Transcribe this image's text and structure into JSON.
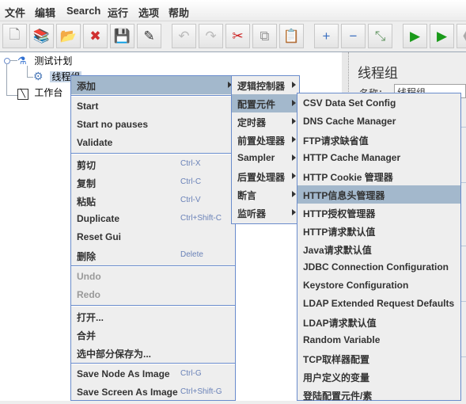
{
  "menubar": [
    "文件",
    "编辑",
    "Search",
    "运行",
    "选项",
    "帮助"
  ],
  "toolbar": [
    {
      "icon": "new-icon",
      "glyph": "🗋"
    },
    {
      "icon": "templates-icon",
      "glyph": "📚"
    },
    {
      "icon": "open-icon",
      "glyph": "📂"
    },
    {
      "icon": "close-icon",
      "glyph": "✖"
    },
    {
      "icon": "save-icon",
      "glyph": "💾"
    },
    {
      "icon": "save-as-icon",
      "glyph": "✎"
    },
    {
      "icon": "undo-icon",
      "glyph": "↶"
    },
    {
      "icon": "redo-icon",
      "glyph": "↷"
    },
    {
      "icon": "cut-icon",
      "glyph": "✂"
    },
    {
      "icon": "copy-icon",
      "glyph": "⧉"
    },
    {
      "icon": "paste-icon",
      "glyph": "📋"
    },
    {
      "icon": "expand-icon",
      "glyph": "+"
    },
    {
      "icon": "collapse-icon",
      "glyph": "−"
    },
    {
      "icon": "toggle-icon",
      "glyph": "⤡"
    },
    {
      "icon": "start-icon",
      "glyph": "▶"
    },
    {
      "icon": "start-no-pauses-icon",
      "glyph": "▶"
    },
    {
      "icon": "stop-icon",
      "glyph": "⬣"
    }
  ],
  "tree": {
    "test_plan": "测试计划",
    "thread_group": "线程组",
    "workbench": "工作台"
  },
  "right_panel": {
    "title": "线程组",
    "name_label": "名称：",
    "name_value": "线程组"
  },
  "context_menu": {
    "items": [
      {
        "label": "添加",
        "submenu": true,
        "selected": true
      },
      {
        "sep": true
      },
      {
        "label": "Start"
      },
      {
        "label": "Start no pauses"
      },
      {
        "label": "Validate"
      },
      {
        "sep": true
      },
      {
        "label": "剪切",
        "accel": "Ctrl-X"
      },
      {
        "label": "复制",
        "accel": "Ctrl-C"
      },
      {
        "label": "粘贴",
        "accel": "Ctrl-V"
      },
      {
        "label": "Duplicate",
        "accel": "Ctrl+Shift-C"
      },
      {
        "label": "Reset Gui"
      },
      {
        "label": "删除",
        "accel": "Delete"
      },
      {
        "sep": true
      },
      {
        "label": "Undo",
        "disabled": true
      },
      {
        "label": "Redo",
        "disabled": true
      },
      {
        "sep": true
      },
      {
        "label": "打开..."
      },
      {
        "label": "合并"
      },
      {
        "label": "选中部分保存为..."
      },
      {
        "sep": true
      },
      {
        "label": "Save Node As Image",
        "accel": "Ctrl-G"
      },
      {
        "label": "Save Screen As Image",
        "accel": "Ctrl+Shift-G"
      }
    ]
  },
  "add_submenu": {
    "items": [
      {
        "label": "逻辑控制器",
        "submenu": true
      },
      {
        "label": "配置元件",
        "submenu": true,
        "selected": true
      },
      {
        "label": "定时器",
        "submenu": true
      },
      {
        "label": "前置处理器",
        "submenu": true
      },
      {
        "label": "Sampler",
        "submenu": true
      },
      {
        "label": "后置处理器",
        "submenu": true
      },
      {
        "label": "断言",
        "submenu": true
      },
      {
        "label": "监听器",
        "submenu": true
      }
    ]
  },
  "config_submenu": {
    "items": [
      {
        "label": "CSV Data Set Config"
      },
      {
        "label": "DNS Cache Manager"
      },
      {
        "label": "FTP请求缺省值"
      },
      {
        "label": "HTTP Cache Manager"
      },
      {
        "label": "HTTP Cookie 管理器"
      },
      {
        "label": "HTTP信息头管理器",
        "selected": true
      },
      {
        "label": "HTTP授权管理器"
      },
      {
        "label": "HTTP请求默认值"
      },
      {
        "label": "Java请求默认值"
      },
      {
        "label": "JDBC Connection Configuration"
      },
      {
        "label": "Keystore Configuration"
      },
      {
        "label": "LDAP Extended Request Defaults"
      },
      {
        "label": "LDAP请求默认值"
      },
      {
        "label": "Random Variable"
      },
      {
        "label": "TCP取样器配置"
      },
      {
        "label": "用户定义的变量"
      },
      {
        "label": "登陆配置元件/素"
      }
    ]
  },
  "colors": {
    "selection": "#a3b8cc",
    "menu_border": "#6a8ccc",
    "accelerator": "#6a82b8"
  }
}
